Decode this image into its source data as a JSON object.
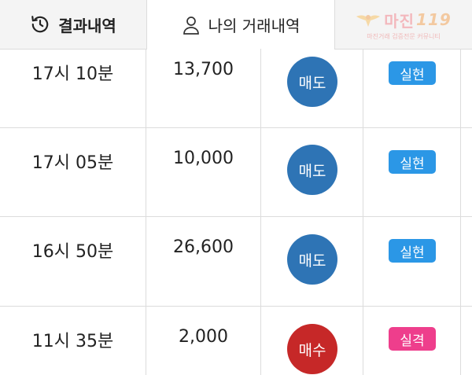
{
  "tabs": {
    "results_label": "결과내역",
    "history_label": "나의 거래내역"
  },
  "logo": {
    "brand": "마진",
    "brand_num": "119",
    "tagline": "마진거래 검증전문 커뮤니티"
  },
  "colors": {
    "sell": "#2e74b5",
    "buy": "#c62828",
    "realized": "#2b97e6",
    "lost": "#ee3e8c"
  },
  "trades": [
    {
      "time": "17시 10분",
      "price": "13,700",
      "type": "매도",
      "type_kind": "sell",
      "result": "실현",
      "result_kind": "realized"
    },
    {
      "time": "17시 05분",
      "price": "10,000",
      "type": "매도",
      "type_kind": "sell",
      "result": "실현",
      "result_kind": "realized"
    },
    {
      "time": "16시 50분",
      "price": "26,600",
      "type": "매도",
      "type_kind": "sell",
      "result": "실현",
      "result_kind": "realized"
    },
    {
      "time": "11시 35분",
      "price": "2,000",
      "type": "매수",
      "type_kind": "buy",
      "result": "실격",
      "result_kind": "lost"
    }
  ]
}
